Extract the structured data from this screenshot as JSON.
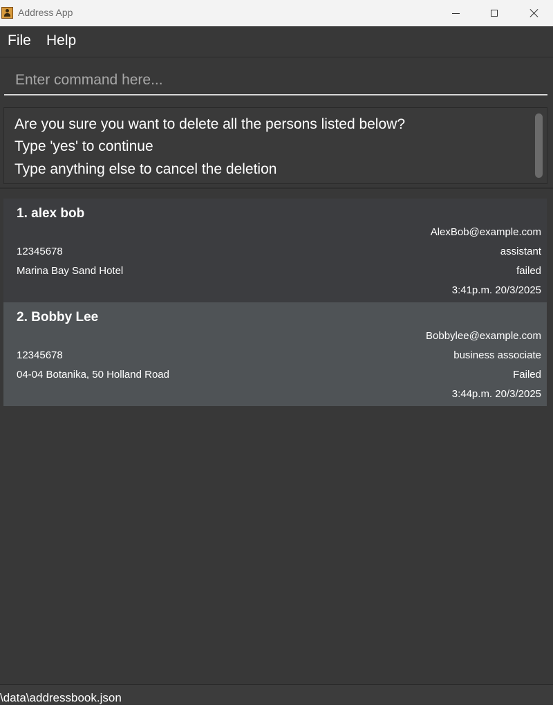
{
  "window": {
    "title": "Address App",
    "icon": "address-book-icon"
  },
  "menu": {
    "items": [
      {
        "label": "File"
      },
      {
        "label": "Help"
      }
    ]
  },
  "command": {
    "value": "",
    "placeholder": "Enter command here..."
  },
  "result": {
    "lines": [
      "Are you sure you want to delete all the persons listed below?",
      "Type 'yes' to continue",
      "Type anything else to cancel the deletion"
    ]
  },
  "persons": [
    {
      "name": "1. alex bob",
      "email": "AlexBob@example.com",
      "phone": "12345678",
      "role": "assistant",
      "address": "Marina Bay Sand Hotel",
      "status": "failed",
      "time": "3:41p.m. 20/3/2025",
      "selected": false
    },
    {
      "name": "2. Bobby Lee",
      "email": "Bobbylee@example.com",
      "phone": "12345678",
      "role": "business associate",
      "address": "04-04 Botanika, 50 Holland Road",
      "status": "Failed",
      "time": "3:44p.m. 20/3/2025",
      "selected": true
    }
  ],
  "statusbar": {
    "path": "\\data\\addressbook.json"
  },
  "colors": {
    "background": "#383838",
    "card": "#3c3d40",
    "card_selected": "#4f5356",
    "titlebar": "#f3f3f3"
  }
}
